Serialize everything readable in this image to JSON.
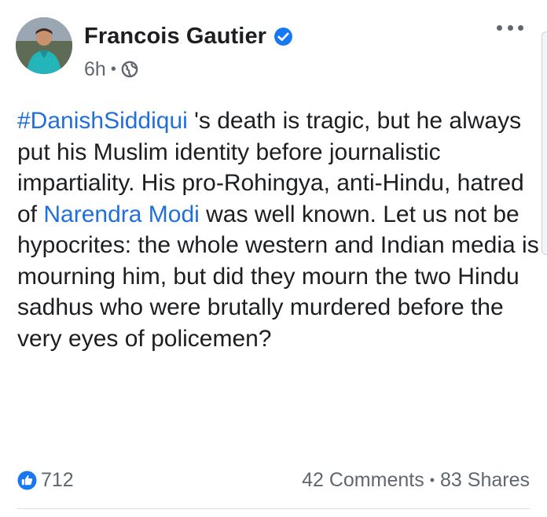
{
  "post": {
    "author": "Francois Gautier",
    "verified": true,
    "time": "6h",
    "privacy_icon": "globe-icon",
    "more_icon": "more-options-icon",
    "text_parts": {
      "hashtag": "#DanishSiddiqui",
      "part1": " 's death is tragic, but he always put his Muslim identity before journalistic impartiality. His pro-Rohingya, anti-Hindu, hatred of ",
      "mention": "Narendra Modi",
      "part2": " was well known. Let us not be hypocrites: the whole western and Indian media is mourning him, but did they mourn the two Hindu sadhus who were brutally murdered before the very eyes of policemen?"
    },
    "reactions_count": "712",
    "comments": "42 Comments",
    "shares": "83 Shares",
    "separator": "•"
  },
  "colors": {
    "link": "#216fdb",
    "verified": "#1877f2",
    "like": "#1877f2",
    "text": "#1c1e21",
    "meta": "#606770"
  }
}
